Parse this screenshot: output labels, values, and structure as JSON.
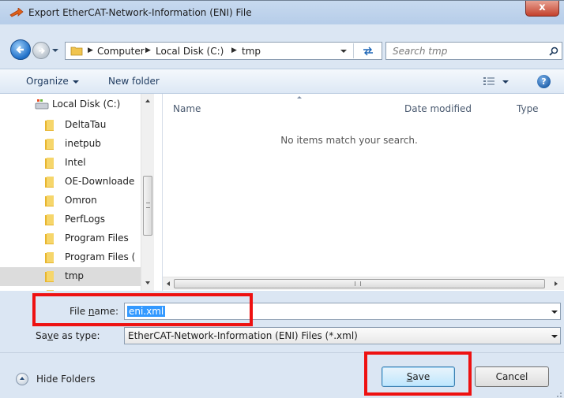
{
  "window": {
    "title": "Export EtherCAT-Network-Information (ENI) File",
    "close_label": "x"
  },
  "address_bar": {
    "crumbs": [
      "Computer",
      "Local Disk (C:)",
      "tmp"
    ],
    "separator": "▶",
    "refresh_glyph": "↹"
  },
  "search": {
    "placeholder": "Search tmp"
  },
  "toolbar": {
    "organize_label": "Organize",
    "new_folder_label": "New folder",
    "help_label": "?"
  },
  "nav_pane": {
    "disk_label": "Local Disk (C:)",
    "items": [
      {
        "label": "DeltaTau",
        "selected": false
      },
      {
        "label": "inetpub",
        "selected": false
      },
      {
        "label": "Intel",
        "selected": false
      },
      {
        "label": "OE-Downloade",
        "selected": false
      },
      {
        "label": "Omron",
        "selected": false
      },
      {
        "label": "PerfLogs",
        "selected": false
      },
      {
        "label": "Program Files",
        "selected": false
      },
      {
        "label": "Program Files (",
        "selected": false
      },
      {
        "label": "tmp",
        "selected": true
      }
    ]
  },
  "file_list": {
    "columns": [
      "Name",
      "Date modified",
      "Type"
    ],
    "empty_message": "No items match your search."
  },
  "form": {
    "file_name_label_pre": "File ",
    "file_name_label_u": "n",
    "file_name_label_post": "ame:",
    "file_name_value": "eni.xml",
    "save_type_label_pre": "Sa",
    "save_type_label_u": "v",
    "save_type_label_post": "e as type:",
    "save_type_value": "EtherCAT-Network-Information (ENI) Files (*.xml)"
  },
  "footer": {
    "hide_folders_label": "Hide Folders",
    "save_label_u": "S",
    "save_label_post": "ave",
    "cancel_label": "Cancel"
  },
  "colors": {
    "highlight": "#ee1111",
    "selection": "#3399ff"
  }
}
